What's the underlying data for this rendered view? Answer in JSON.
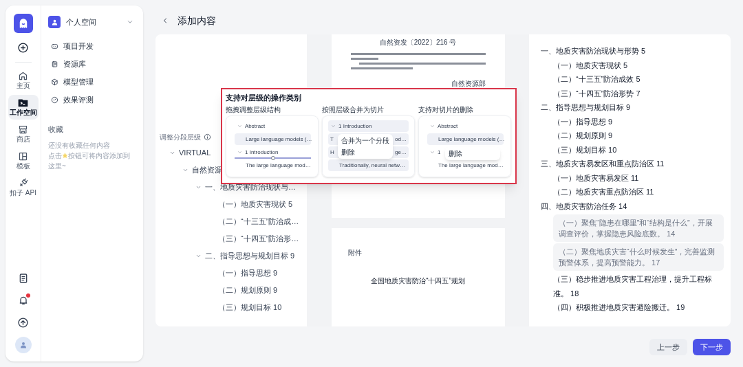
{
  "rail": {
    "items": [
      {
        "label": "主页",
        "selected": false
      },
      {
        "label": "工作空间",
        "selected": true
      },
      {
        "label": "商店",
        "selected": false
      },
      {
        "label": "模板",
        "selected": false
      },
      {
        "label": "扣子 API",
        "selected": false
      }
    ],
    "notification_dot": true
  },
  "space": {
    "title": "个人空间",
    "menu": [
      {
        "label": "项目开发"
      },
      {
        "label": "资源库"
      },
      {
        "label": "模型管理"
      },
      {
        "label": "效果评测"
      }
    ],
    "favorites": {
      "title": "收藏",
      "empty": "还没有收藏任何内容",
      "hint_before": "点击",
      "hint_after": "按钮可将内容添加到",
      "hint_end": "这里~"
    }
  },
  "header": {
    "title": "添加内容"
  },
  "tree": {
    "label": "调整分段层级",
    "items": [
      {
        "text": "VIRTUAL",
        "expanded": true,
        "children": [
          {
            "text": "自然资源",
            "expanded": true,
            "children": [
              {
                "text": "一、地质灾害防治现状与…",
                "expanded": true,
                "children": [
                  {
                    "text": "（一）地质灾害现状 5"
                  },
                  {
                    "text": "（二）“十三五”防治成…"
                  },
                  {
                    "text": "（三）“十四五”防治形…"
                  }
                ]
              },
              {
                "text": "二、指导思想与规划目标 9",
                "expanded": true,
                "children": [
                  {
                    "text": "（一）指导思想 9"
                  },
                  {
                    "text": "（二）规划原则 9"
                  },
                  {
                    "text": "（三）规划目标 10"
                  }
                ]
              }
            ]
          }
        ]
      }
    ]
  },
  "document": {
    "pages": [
      {
        "number": "自然资发〔2022〕216 号",
        "signature": "自然资源部"
      },
      {
        "label": "附件",
        "title": "全国地质灾害防治“十四五”规划"
      }
    ]
  },
  "outline": [
    {
      "text": "一、地质灾害防治现状与形势 5",
      "children": [
        {
          "text": "（一）地质灾害现状 5",
          "highlighted": false
        },
        {
          "text": "（二）“十三五”防治成效 5",
          "highlighted": false
        },
        {
          "text": "（三）“十四五”防治形势 7",
          "highlighted": false
        }
      ]
    },
    {
      "text": "二、指导思想与规划目标 9",
      "children": [
        {
          "text": "（一）指导思想 9",
          "highlighted": false
        },
        {
          "text": "（二）规划原则 9",
          "highlighted": false
        },
        {
          "text": "（三）规划目标 10",
          "highlighted": false
        }
      ]
    },
    {
      "text": "三、地质灾害易发区和重点防治区 11",
      "children": [
        {
          "text": "（一）地质灾害易发区 11",
          "highlighted": false
        },
        {
          "text": "（二）地质灾害重点防治区 11",
          "highlighted": false
        }
      ]
    },
    {
      "text": "四、地质灾害防治任务 14",
      "children": [
        {
          "text": "（一）聚焦“隐患在哪里”和“结构是什么”，开展调查评价，掌握隐患风险底数。  14",
          "highlighted": true
        },
        {
          "text": "（二）聚焦地质灾害“什么时候发生”，完善监测预警体系，提高预警能力。 17",
          "highlighted": true
        },
        {
          "text": "（三）稳步推进地质灾害工程治理，提升工程标准。 18",
          "highlighted": false
        },
        {
          "text": "（四）积极推进地质灾害避险搬迁。 19",
          "highlighted": false
        }
      ]
    }
  ],
  "overlay": {
    "title": "支持对层级的操作类别",
    "panels": [
      {
        "heading": "拖拽调整层级结构",
        "rows": [
          {
            "kind": "heading",
            "text": "Abstract",
            "highlighted": false
          },
          {
            "kind": "item",
            "text": "Large language models (…",
            "highlighted": true
          },
          {
            "kind": "heading",
            "text": "1 Introduction",
            "highlighted": false,
            "drop_indicator": true
          },
          {
            "kind": "item",
            "text": "The large language mod…",
            "highlighted": false
          }
        ]
      },
      {
        "heading": "按照层级合并为切片",
        "rows": [
          {
            "kind": "heading",
            "text": "1 Introduction",
            "highlighted": true
          },
          {
            "kind": "item",
            "text": "T",
            "text_end": "od…",
            "highlighted": true,
            "menu": [
              "合并为一个分段",
              "删除"
            ]
          },
          {
            "kind": "item",
            "text": "H",
            "text_end": "ge…",
            "highlighted": true
          },
          {
            "kind": "item",
            "text": "Traditionally, neural netw…",
            "highlighted": true
          }
        ]
      },
      {
        "heading": "支持对切片的删除",
        "rows": [
          {
            "kind": "heading",
            "text": "Abstract",
            "highlighted": false
          },
          {
            "kind": "item",
            "text": "Large language models (…",
            "highlighted": true
          },
          {
            "kind": "heading",
            "text": "1",
            "highlighted": false,
            "menu": [
              "删除"
            ]
          },
          {
            "kind": "item",
            "text": "The large language mod…",
            "highlighted": false
          }
        ]
      }
    ]
  },
  "buttons": {
    "back": "上一步",
    "next": "下一步"
  }
}
